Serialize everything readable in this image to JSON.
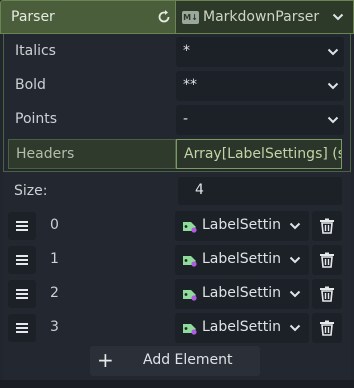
{
  "header": {
    "title": "Parser",
    "resource_badge": "M↓",
    "resource_name": "MarkdownParser"
  },
  "properties": [
    {
      "label": "Italics",
      "value": "*"
    },
    {
      "label": "Bold",
      "value": "**"
    },
    {
      "label": "Points",
      "value": "-"
    }
  ],
  "headers": {
    "label": "Headers",
    "value": "Array[LabelSettings] (si"
  },
  "array": {
    "size_label": "Size:",
    "size_value": "4",
    "items": [
      {
        "index": "0",
        "value": "LabelSettin"
      },
      {
        "index": "1",
        "value": "LabelSettin"
      },
      {
        "index": "2",
        "value": "LabelSettin"
      },
      {
        "index": "3",
        "value": "LabelSettin"
      }
    ],
    "add_label": "Add Element"
  },
  "icons": {
    "revert": "revert-icon",
    "dropdown": "chevron-down-icon",
    "drag": "drag-handle-icon",
    "label_settings": "label-settings-icon",
    "delete": "trash-icon",
    "add": "plus-icon"
  },
  "colors": {
    "background": "#21262e",
    "field": "#1c2027",
    "section_header": "#4b5e3c",
    "accent_green": "#7c9b62"
  }
}
